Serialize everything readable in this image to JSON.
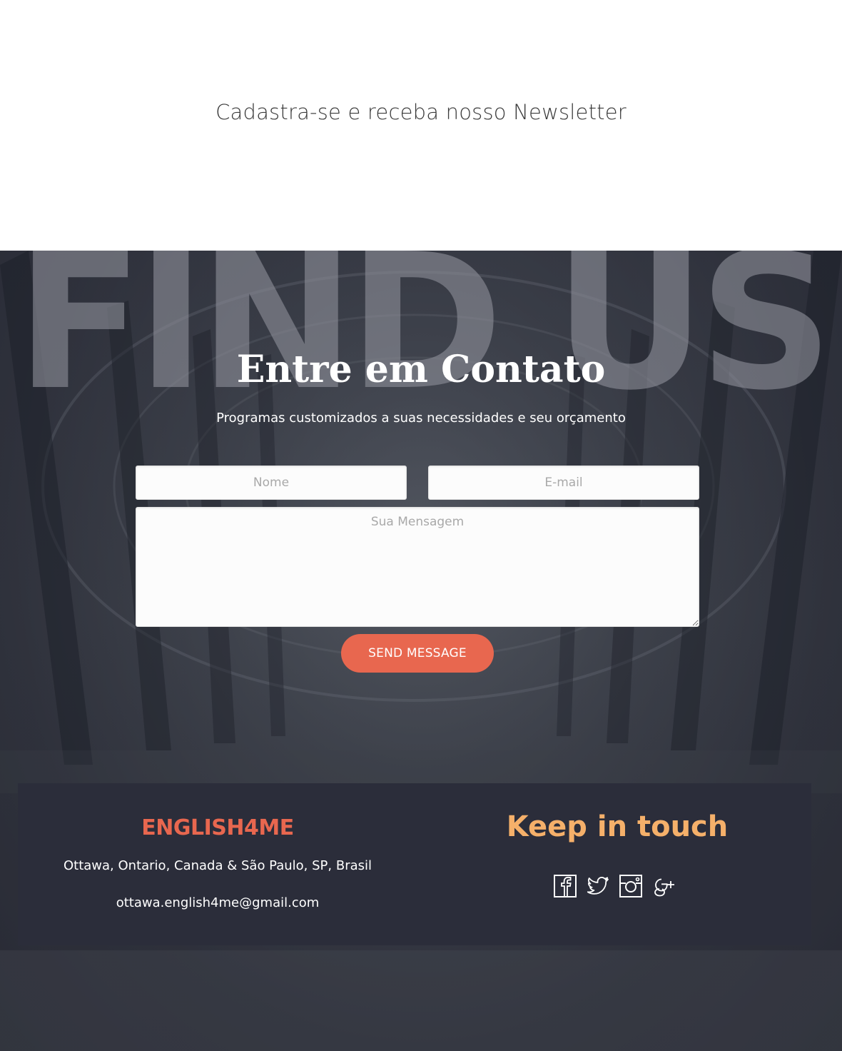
{
  "newsletter": {
    "title": "Cadastra-se e receba nosso Newsletter"
  },
  "contact": {
    "background_text": "FIND US",
    "title": "Entre em Contato",
    "subtitle": "Programas customizados a suas necessidades e seu orçamento",
    "form": {
      "name_placeholder": "Nome",
      "email_placeholder": "E-mail",
      "message_placeholder": "Sua Mensagem",
      "submit_label": "SEND MESSAGE"
    }
  },
  "footer": {
    "brand": "ENGLISH4ME",
    "address": "Ottawa, Ontario, Canada & São Paulo, SP, Brasil",
    "email": "ottawa.english4me@gmail.com",
    "keep_in_touch": "Keep in touch",
    "social": [
      {
        "icon": "facebook-icon"
      },
      {
        "icon": "twitter-icon"
      },
      {
        "icon": "instagram-icon"
      },
      {
        "icon": "google-plus-icon"
      }
    ]
  },
  "colors": {
    "accent": "#e8674f",
    "keep_in_touch": "#f5b06a",
    "footer_bg": "#2b2d3a"
  }
}
